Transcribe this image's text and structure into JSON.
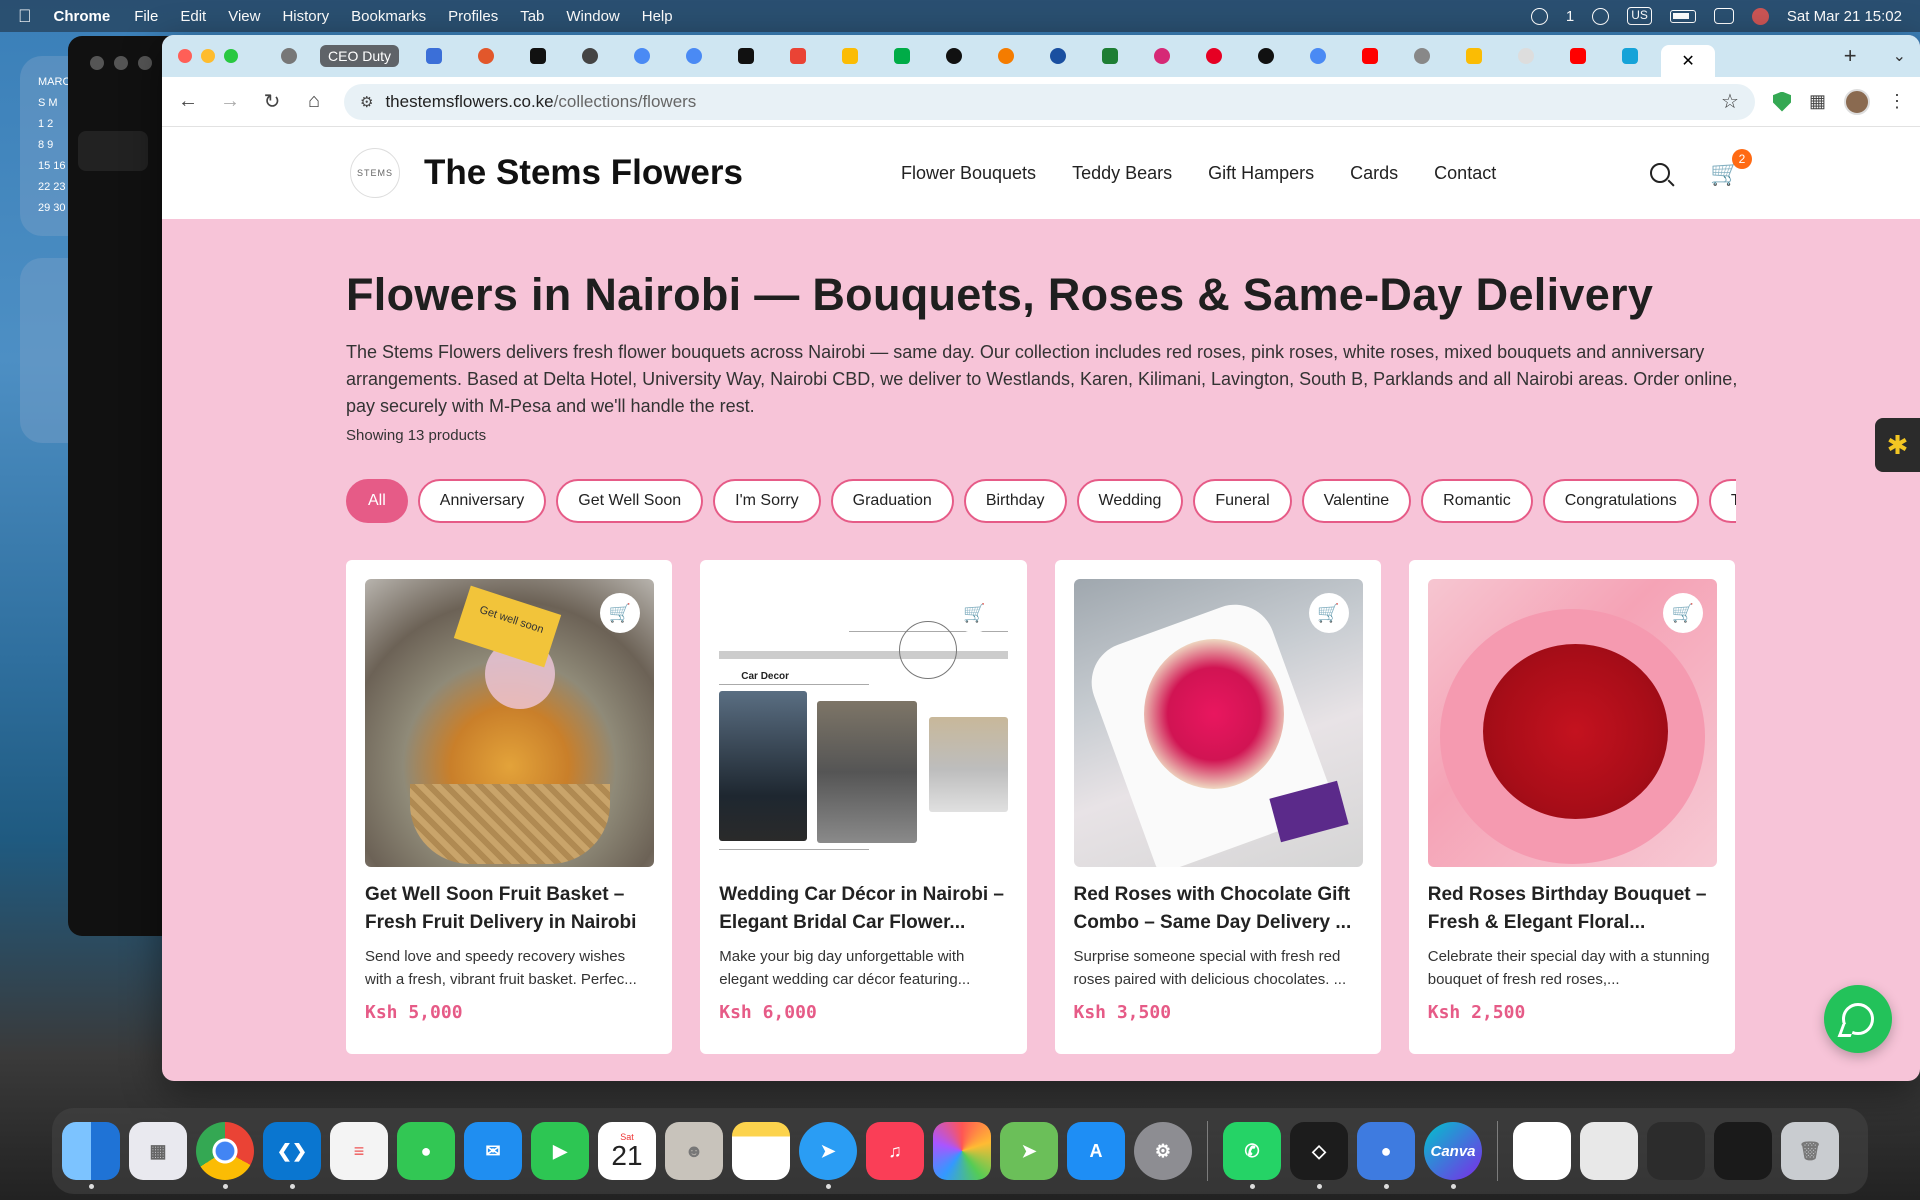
{
  "menubar": {
    "app_name": "Chrome",
    "items": [
      "File",
      "Edit",
      "View",
      "History",
      "Bookmarks",
      "Profiles",
      "Tab",
      "Window",
      "Help"
    ],
    "status_count": "1",
    "input_source": "US",
    "datetime": "Sat Mar 21  15:02"
  },
  "desktop": {
    "calendar_widget_month": "MARC",
    "calendar_rows": [
      "S  M",
      "1  2",
      "8  9",
      "15 16",
      "22 23",
      "29 30"
    ]
  },
  "browser": {
    "tab_group_label": "CEO Duty",
    "url_host": "thestemsflowers.co.ke",
    "url_path": "/collections/flowers"
  },
  "site": {
    "brand": "The Stems Flowers",
    "nav": [
      "Flower Bouquets",
      "Teddy Bears",
      "Gift Hampers",
      "Cards",
      "Contact"
    ],
    "cart_count": "2"
  },
  "page": {
    "title": "Flowers in Nairobi — Bouquets, Roses & Same-Day Delivery",
    "intro": "The Stems Flowers delivers fresh flower bouquets across Nairobi — same day. Our collection includes red roses, pink roses, white roses, mixed bouquets and anniversary arrangements. Based at Delta Hotel, University Way, Nairobi CBD, we deliver to Westlands, Karen, Kilimani, Lavington, South B, Parklands and all Nairobi areas. Order online, pay securely with M-Pesa and we'll handle the rest.",
    "count": "Showing 13 products"
  },
  "filters": [
    "All",
    "Anniversary",
    "Get Well Soon",
    "I'm Sorry",
    "Graduation",
    "Birthday",
    "Wedding",
    "Funeral",
    "Valentine",
    "Romantic",
    "Congratulations",
    "Thank"
  ],
  "products": [
    {
      "title": "Get Well Soon Fruit Basket – Fresh Fruit Delivery in Nairobi",
      "desc": "Send love and speedy recovery wishes with a fresh, vibrant fruit basket. Perfec...",
      "price": "Ksh 5,000",
      "img_text": "Get well soon"
    },
    {
      "title": "Wedding Car Décor in Nairobi – Elegant Bridal Car Flower...",
      "desc": "Make your big day unforgettable with elegant wedding car décor featuring...",
      "price": "Ksh 6,000",
      "img_text": "Car Decor"
    },
    {
      "title": "Red Roses with Chocolate Gift Combo – Same Day Delivery ...",
      "desc": "Surprise someone special with fresh red roses paired with delicious chocolates. ...",
      "price": "Ksh 3,500",
      "img_text": ""
    },
    {
      "title": "Red Roses Birthday Bouquet – Fresh & Elegant Floral...",
      "desc": "Celebrate their special day with a stunning bouquet of fresh red roses,...",
      "price": "Ksh 2,500",
      "img_text": ""
    }
  ],
  "dock": {
    "calendar_day": "Sat",
    "calendar_date": "21",
    "canva_label": "Canva"
  }
}
